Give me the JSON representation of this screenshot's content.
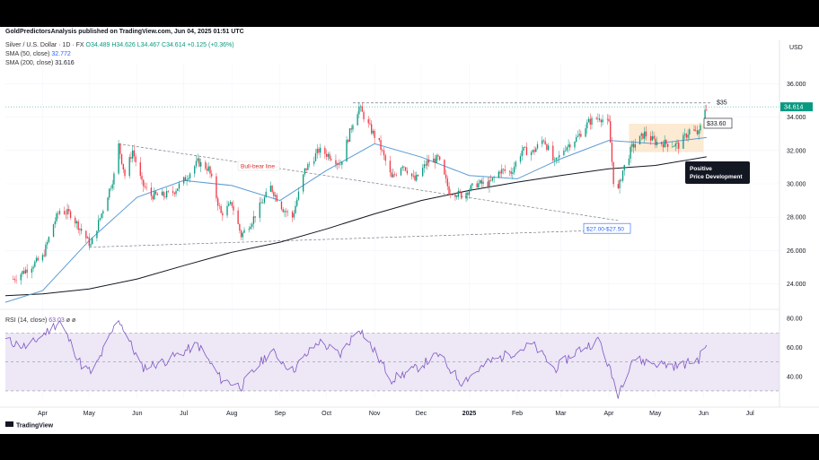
{
  "publisher_line": "GoldPredictorsAnalysis published on TradingView.com, Jun 04, 2025 01:51 UTC",
  "symbol": {
    "name": "Silver / U.S. Dollar",
    "interval": "1D",
    "source": "FX",
    "open": "O34.489",
    "high": "H34.626",
    "low": "L34.467",
    "close": "C34.614",
    "change": "+0.125 (+0.36%)"
  },
  "indicators": {
    "sma50_label": "SMA (50, close)",
    "sma50_value": "32.772",
    "sma200_label": "SMA (200, close)",
    "sma200_value": "31.616",
    "rsi_label": "RSI (14, close)",
    "rsi_value": "63.03",
    "rsi_extra": "ø ø"
  },
  "currency": "USD",
  "branding": "TradingView",
  "colors": {
    "up": "#089981",
    "down": "#f23645",
    "sma50": "#5b9bd5",
    "sma200": "#131722",
    "rsi": "#7e57c2",
    "rsi_band": "#ede7f6",
    "annotation_blue": "#2962ff",
    "annotation_red": "#d32f2f",
    "consolidation_box": "#fbe3c4"
  },
  "chart_data": {
    "type": "candlestick",
    "ylim": [
      22.8,
      37.2
    ],
    "y_ticks": [
      "36.000",
      "34.000",
      "32.000",
      "30.000",
      "28.000",
      "26.000",
      "24.000"
    ],
    "x_ticks": [
      "Apr",
      "May",
      "Jun",
      "Jul",
      "Aug",
      "Sep",
      "Oct",
      "Nov",
      "Dec",
      "2025",
      "Feb",
      "Mar",
      "Apr",
      "May",
      "Jun",
      "Jul"
    ],
    "last_price": "34.614",
    "price_path": [
      [
        "2024-03-13",
        24.3
      ],
      [
        "2024-03-22",
        24.9
      ],
      [
        "2024-04-01",
        25.6
      ],
      [
        "2024-04-08",
        27.6
      ],
      [
        "2024-04-12",
        28.4
      ],
      [
        "2024-04-19",
        28.2
      ],
      [
        "2024-04-26",
        27.2
      ],
      [
        "2024-05-02",
        26.3
      ],
      [
        "2024-05-10",
        28.5
      ],
      [
        "2024-05-17",
        30.5
      ],
      [
        "2024-05-20",
        32.3
      ],
      [
        "2024-05-24",
        30.5
      ],
      [
        "2024-05-29",
        32.0
      ],
      [
        "2024-06-04",
        30.0
      ],
      [
        "2024-06-10",
        29.3
      ],
      [
        "2024-06-18",
        29.3
      ],
      [
        "2024-06-24",
        29.5
      ],
      [
        "2024-07-01",
        30.2
      ],
      [
        "2024-07-10",
        31.3
      ],
      [
        "2024-07-17",
        30.9
      ],
      [
        "2024-07-25",
        28.2
      ],
      [
        "2024-08-01",
        28.8
      ],
      [
        "2024-08-07",
        26.9
      ],
      [
        "2024-08-14",
        27.8
      ],
      [
        "2024-08-26",
        29.8
      ],
      [
        "2024-09-03",
        28.5
      ],
      [
        "2024-09-09",
        28.0
      ],
      [
        "2024-09-17",
        30.8
      ],
      [
        "2024-09-26",
        32.0
      ],
      [
        "2024-10-03",
        31.7
      ],
      [
        "2024-10-10",
        31.2
      ],
      [
        "2024-10-18",
        33.7
      ],
      [
        "2024-10-22",
        34.6
      ],
      [
        "2024-10-28",
        33.5
      ],
      [
        "2024-11-04",
        32.4
      ],
      [
        "2024-11-12",
        30.3
      ],
      [
        "2024-11-19",
        31.2
      ],
      [
        "2024-11-27",
        30.2
      ],
      [
        "2024-12-05",
        31.3
      ],
      [
        "2024-12-12",
        31.5
      ],
      [
        "2024-12-19",
        29.6
      ],
      [
        "2024-12-27",
        29.3
      ],
      [
        "2025-01-06",
        30.0
      ],
      [
        "2025-01-14",
        30.0
      ],
      [
        "2025-01-21",
        30.8
      ],
      [
        "2025-01-28",
        30.7
      ],
      [
        "2025-02-04",
        32.0
      ],
      [
        "2025-02-11",
        31.9
      ],
      [
        "2025-02-18",
        32.7
      ],
      [
        "2025-02-25",
        31.2
      ],
      [
        "2025-03-04",
        32.2
      ],
      [
        "2025-03-12",
        32.8
      ],
      [
        "2025-03-19",
        33.7
      ],
      [
        "2025-03-26",
        34.0
      ],
      [
        "2025-04-01",
        33.6
      ],
      [
        "2025-04-04",
        30.2
      ],
      [
        "2025-04-07",
        29.6
      ],
      [
        "2025-04-10",
        30.8
      ],
      [
        "2025-04-16",
        32.2
      ],
      [
        "2025-04-24",
        33.0
      ],
      [
        "2025-05-01",
        32.5
      ],
      [
        "2025-05-09",
        32.4
      ],
      [
        "2025-05-16",
        32.3
      ],
      [
        "2025-05-23",
        33.2
      ],
      [
        "2025-05-29",
        33.0
      ],
      [
        "2025-06-02",
        34.5
      ],
      [
        "2025-06-03",
        34.614
      ]
    ],
    "sma50": [
      [
        "2024-03-08",
        22.9
      ],
      [
        "2024-04-01",
        23.6
      ],
      [
        "2024-05-01",
        26.6
      ],
      [
        "2024-06-01",
        29.2
      ],
      [
        "2024-07-01",
        30.2
      ],
      [
        "2024-08-01",
        29.9
      ],
      [
        "2024-09-01",
        29.0
      ],
      [
        "2024-10-01",
        30.8
      ],
      [
        "2024-11-01",
        32.4
      ],
      [
        "2024-12-01",
        31.6
      ],
      [
        "2025-01-01",
        30.5
      ],
      [
        "2025-02-01",
        30.3
      ],
      [
        "2025-03-01",
        31.5
      ],
      [
        "2025-04-01",
        32.6
      ],
      [
        "2025-05-01",
        32.4
      ],
      [
        "2025-06-03",
        32.772
      ]
    ],
    "sma200": [
      [
        "2024-03-08",
        23.3
      ],
      [
        "2024-04-01",
        23.4
      ],
      [
        "2024-05-01",
        23.7
      ],
      [
        "2024-06-01",
        24.3
      ],
      [
        "2024-07-01",
        25.1
      ],
      [
        "2024-08-01",
        25.9
      ],
      [
        "2024-09-01",
        26.5
      ],
      [
        "2024-10-01",
        27.3
      ],
      [
        "2024-11-01",
        28.2
      ],
      [
        "2024-12-01",
        29.0
      ],
      [
        "2025-01-01",
        29.6
      ],
      [
        "2025-02-01",
        30.1
      ],
      [
        "2025-03-01",
        30.5
      ],
      [
        "2025-04-01",
        30.9
      ],
      [
        "2025-05-01",
        31.1
      ],
      [
        "2025-06-03",
        31.616
      ]
    ],
    "rsi": {
      "ylim": [
        25,
        85
      ],
      "y_ticks": [
        "80.00",
        "60.00",
        "40.00"
      ],
      "levels": [
        70,
        50,
        30
      ],
      "path": [
        [
          "2024-03-08",
          65
        ],
        [
          "2024-03-22",
          60
        ],
        [
          "2024-04-05",
          72
        ],
        [
          "2024-04-12",
          78
        ],
        [
          "2024-04-26",
          48
        ],
        [
          "2024-05-03",
          42
        ],
        [
          "2024-05-20",
          80
        ],
        [
          "2024-06-04",
          46
        ],
        [
          "2024-06-18",
          50
        ],
        [
          "2024-07-10",
          62
        ],
        [
          "2024-07-25",
          38
        ],
        [
          "2024-08-07",
          33
        ],
        [
          "2024-08-26",
          58
        ],
        [
          "2024-09-09",
          44
        ],
        [
          "2024-09-26",
          64
        ],
        [
          "2024-10-10",
          55
        ],
        [
          "2024-10-22",
          74
        ],
        [
          "2024-11-12",
          38
        ],
        [
          "2024-11-27",
          45
        ],
        [
          "2024-12-12",
          55
        ],
        [
          "2024-12-27",
          36
        ],
        [
          "2025-01-14",
          50
        ],
        [
          "2025-01-28",
          56
        ],
        [
          "2025-02-11",
          62
        ],
        [
          "2025-02-25",
          45
        ],
        [
          "2025-03-12",
          58
        ],
        [
          "2025-03-26",
          65
        ],
        [
          "2025-04-07",
          28
        ],
        [
          "2025-04-16",
          52
        ],
        [
          "2025-05-01",
          49
        ],
        [
          "2025-05-16",
          47
        ],
        [
          "2025-05-29",
          52
        ],
        [
          "2025-06-03",
          63
        ]
      ]
    },
    "annotations": [
      {
        "type": "label",
        "text": "Bull-bear line",
        "color": "red"
      },
      {
        "type": "label",
        "text": "$35"
      },
      {
        "type": "label",
        "text": "$33.60"
      },
      {
        "type": "label",
        "text": "$27.00-$27.50",
        "color": "blue"
      },
      {
        "type": "callout",
        "text": "Positive Price Development"
      }
    ],
    "trendlines": [
      {
        "name": "resistance-35",
        "from": [
          "2024-10-18",
          34.85
        ],
        "to": [
          "2025-06-06",
          34.85
        ]
      },
      {
        "name": "bull-bear-line",
        "from": [
          "2024-05-20",
          32.4
        ],
        "to": [
          "2025-04-07",
          27.8
        ]
      },
      {
        "name": "support-27",
        "from": [
          "2024-05-01",
          26.2
        ],
        "to": [
          "2025-04-07",
          27.25
        ]
      }
    ],
    "consolidation_box": {
      "from": "2025-04-14",
      "to": "2025-06-01",
      "low": 31.9,
      "high": 33.6
    }
  }
}
